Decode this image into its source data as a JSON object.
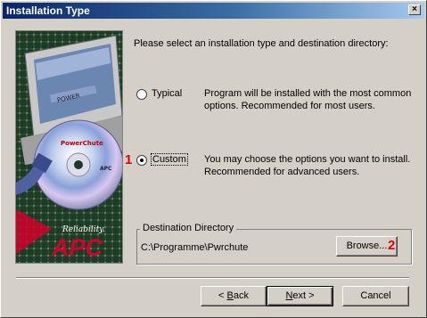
{
  "window": {
    "title": "Installation Type",
    "close_glyph": "×"
  },
  "image": {
    "tagline": "Reliability.",
    "brand": "APC",
    "disc_label": "PowerChute",
    "screen_text": "POWER"
  },
  "prompt": "Please select an installation type and destination directory:",
  "options": [
    {
      "label": "Typical",
      "selected": false,
      "description": "Program will be installed with the most common options. Recommended for most users."
    },
    {
      "label": "Custom",
      "selected": true,
      "description": "You may choose the options you want to install. Recommended for advanced users."
    }
  ],
  "markers": {
    "custom": "1",
    "browse": "2"
  },
  "destination": {
    "group_title": "Destination Directory",
    "path": "C:\\Programme\\Pwrchute",
    "browse_label": "Browse..."
  },
  "buttons": {
    "back_pre": "< ",
    "back_u": "B",
    "back_post": "ack",
    "next_u": "N",
    "next_post": "ext >",
    "cancel": "Cancel"
  },
  "colors": {
    "titlebar": "#0a246a",
    "marker": "#e00000",
    "face": "#d4d0c8",
    "brand_red": "#d4002a"
  }
}
